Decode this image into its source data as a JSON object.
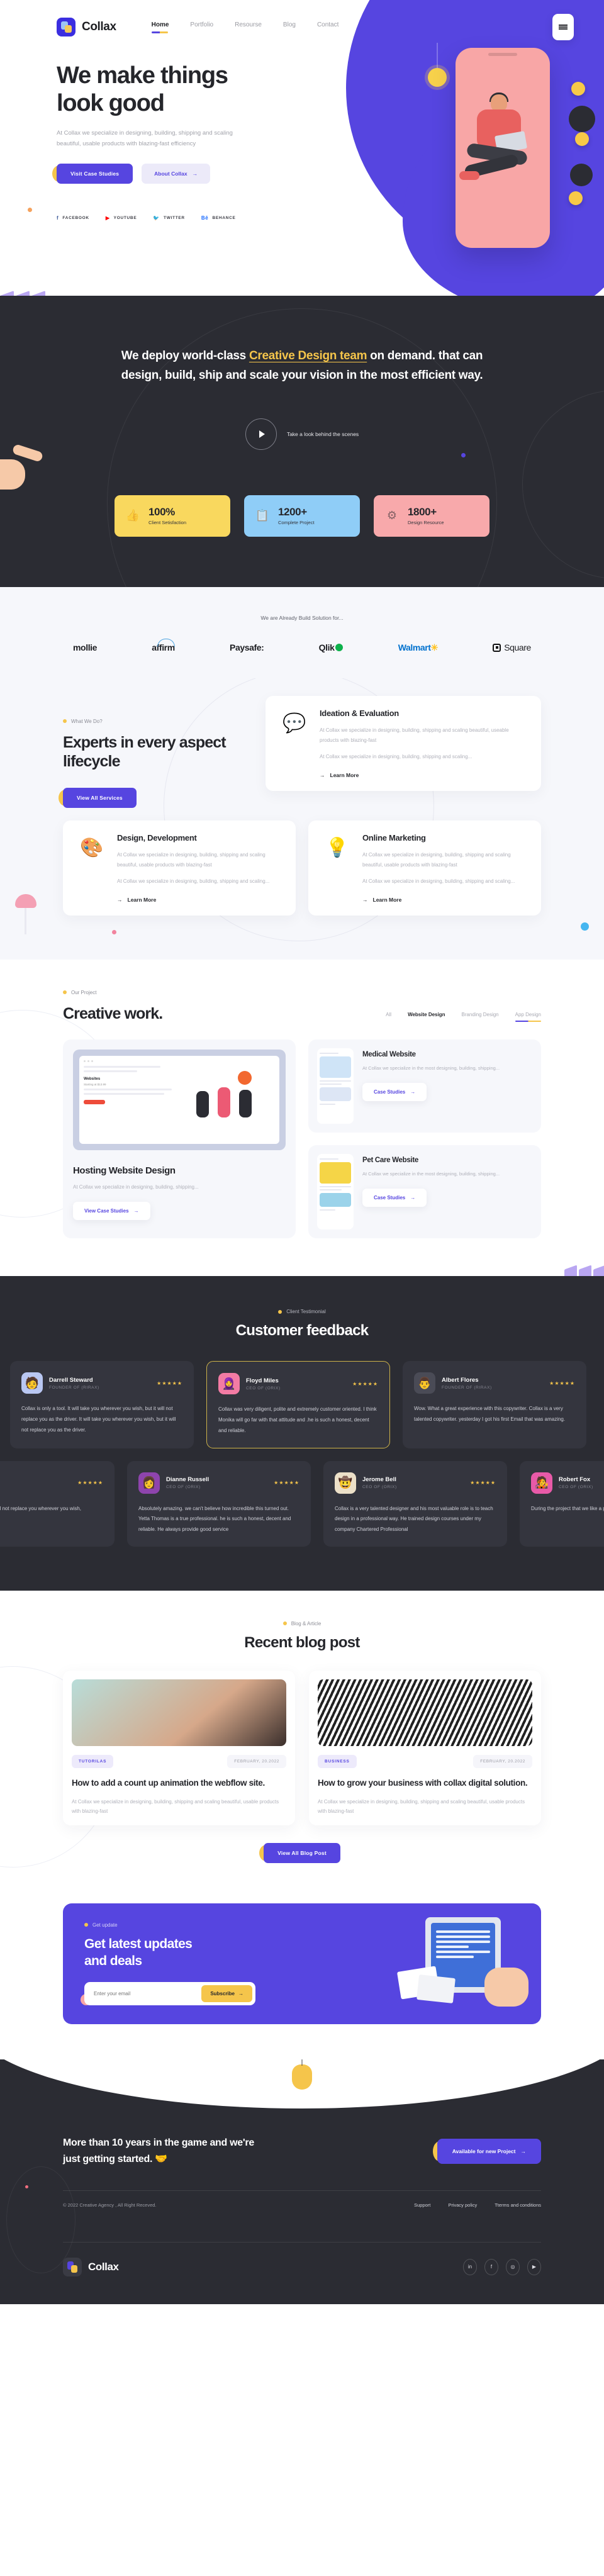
{
  "brand": {
    "name": "Collax"
  },
  "nav": {
    "items": [
      {
        "label": "Home",
        "active": true
      },
      {
        "label": "Portfolio",
        "active": false
      },
      {
        "label": "Resourse",
        "active": false
      },
      {
        "label": "Blog",
        "active": false
      },
      {
        "label": "Contact",
        "active": false
      }
    ],
    "menu_icon": "hamburger-icon"
  },
  "hero": {
    "title_line1": "We make things",
    "title_line2": "look good",
    "subtitle": "At Collax we specialize in designing, building, shipping and scaling beautiful, usable products with blazing-fast efficiency",
    "primary_cta": "Visit Case Studies",
    "secondary_cta": "About Collax",
    "secondary_arrow": "→",
    "socials": [
      {
        "label": "FACEBOOK",
        "icon": "facebook-icon",
        "glyph": "f"
      },
      {
        "label": "YOUTUBE",
        "icon": "youtube-icon",
        "glyph": "▶"
      },
      {
        "label": "TWITTER",
        "icon": "twitter-icon",
        "glyph": "🐦"
      },
      {
        "label": "BEHANCE",
        "icon": "behance-icon",
        "glyph": "Bē"
      }
    ]
  },
  "deploy": {
    "text_before": "We deploy world-class ",
    "highlight": "Creative Design team",
    "text_after": " on demand. that can design, build, ship and scale your vision in the most efficient way.",
    "play_label": "Take a look behind the scenes",
    "stats": [
      {
        "value": "100%",
        "label": "Client Setisfaction",
        "color": "#f9d85e",
        "icon": "thumbs-up-icon",
        "glyph": "👍"
      },
      {
        "value": "1200+",
        "label": "Complete Project",
        "color": "#8fcdf7",
        "icon": "clipboard-icon",
        "glyph": "📋"
      },
      {
        "value": "1800+",
        "label": "Design Resource",
        "color": "#f8a9ab",
        "icon": "gear-icon",
        "glyph": "⚙"
      }
    ]
  },
  "brands": {
    "title": "We are Already Build Solution for...",
    "items": [
      "mollie",
      "affirm",
      "Paysafe:",
      "Qlik",
      "Walmart",
      "Square"
    ]
  },
  "services": {
    "eyebrow": "What We Do?",
    "title": "Experts in every aspect lifecycle",
    "cta": "View All Services",
    "cards": [
      {
        "title": "Ideation & Evaluation",
        "icon": "chat-bubble-icon",
        "glyph": "💬",
        "p1": "At Collax we specialize in designing, building, shipping and scaling beautiful, useable products with blazing-fast",
        "p2": "At Collax we specialize in designing, building, shipping and scaling...",
        "link": "Learn More"
      },
      {
        "title": "Design, Development",
        "icon": "paint-bucket-icon",
        "glyph": "🎨",
        "p1": "At Collax we specialize in designing, building, shipping and scaling beautiful, usable products with blazing-fast",
        "p2": "At Collax we specialize in designing, building, shipping and scaling...",
        "link": "Learn More"
      },
      {
        "title": "Online Marketing",
        "icon": "lightbulb-icon",
        "glyph": "💡",
        "p1": "At Collax we specialize in designing, building, shipping and scaling beautiful, usable products with blazing-fast",
        "p2": "At Collax we specialize in designing, building, shipping and scaling...",
        "link": "Learn More"
      }
    ]
  },
  "portfolio": {
    "eyebrow": "Our Project",
    "title": "Creative work.",
    "tabs": [
      {
        "label": "All",
        "state": "normal"
      },
      {
        "label": "Website Design",
        "state": "bold"
      },
      {
        "label": "Branding Design",
        "state": "normal"
      },
      {
        "label": "App Design",
        "state": "underlined"
      }
    ],
    "featured": {
      "title": "Hosting Website Design",
      "desc": "At Collax we specialize in designing, building, shipping...",
      "cta": "View Case Studies",
      "cta_arrow": "→",
      "shot_heading": "Websites",
      "shot_sub": "Starting at $13.99"
    },
    "items": [
      {
        "title": "Medical Website",
        "desc": "At Collax we specialize in the most designing, building, shipping...",
        "cta": "Case Studies",
        "cta_arrow": "→"
      },
      {
        "title": "Pet Care Website",
        "desc": "At Collax we specialize in the most designing, building, shipping...",
        "cta": "Case Studies",
        "cta_arrow": "→"
      }
    ]
  },
  "testimonials": {
    "eyebrow": "Client Testimonial",
    "title": "Customer feedback",
    "row1": [
      {
        "name": "Darrell Steward",
        "role": "FOUNDER OF (RIRAX)",
        "stars": "★★★★★",
        "text": "Collax is only a tool. It will take you wherever you wish, but it will not replace you as the driver. It will take you wherever you wish, but it will not replace you as the driver.",
        "avatar_color": "#b9c7f2",
        "avatar_glyph": "🧑",
        "active": false
      },
      {
        "name": "Floyd Miles",
        "role": "CEO OF (ORIX)",
        "stars": "★★★★★",
        "text": "Collax was very diligent, polite and extremely customer oriented. I think Monika will go far with that attitude and  .he is such a honest, decent and reliable.",
        "avatar_color": "#f37ba4",
        "avatar_glyph": "🧕",
        "active": true
      },
      {
        "name": "Albert Flores",
        "role": "FOUNDER OF (RIRAX)",
        "stars": "★★★★★",
        "text": "Wow. What a great experience with this copywriter. Collax is a very talented copywriter. yesterday I got his first Email that was amazing.",
        "avatar_color": "#4a4b56",
        "avatar_glyph": "👨",
        "active": false
      }
    ],
    "row2": [
      {
        "name": "",
        "role": "",
        "stars": "★★★★★",
        "text": "...rever you wish, but it will not replace you wherever you wish,",
        "avatar_color": "#4a4b56",
        "avatar_glyph": "",
        "active": false
      },
      {
        "name": "Dianne Russell",
        "role": "CEO OF (ORIX)",
        "stars": "★★★★★",
        "text": "Absolutely amazing. we can't believe how incredible this turned out. Yetta Thomas is a true professional. he is such a honest, decent and reliable. He always provide good service",
        "avatar_color": "#8e44ad",
        "avatar_glyph": "👩",
        "active": false
      },
      {
        "name": "Jerome Bell",
        "role": "CEO OF (ORIX)",
        "stars": "★★★★★",
        "text": "Collax is a very talented designer and his most valuable role is to teach design in a professional way. He trained design courses under my company Chartered Professional",
        "avatar_color": "#ece0c8",
        "avatar_glyph": "🤠",
        "active": false
      },
      {
        "name": "Robert Fox",
        "role": "CEO OF (ORIX)",
        "stars": "★★★★★",
        "text": "During the project that we like a partner rather than to detail.",
        "avatar_color": "#e85aa8",
        "avatar_glyph": "🧑‍🎤",
        "active": false
      }
    ]
  },
  "blog": {
    "eyebrow": "Blog & Article",
    "title": "Recent blog post",
    "cta": "View All Blog Post",
    "posts": [
      {
        "tag": "TUTORILAS",
        "date": "FEBRUARY, 20.2022",
        "title": "How to add a count up animation the webflow site.",
        "excerpt": "At Collax we specialize in designing, building, shipping and scaling beautiful, usable products with blazing-fast"
      },
      {
        "tag": "BUSINESS",
        "date": "FEBRUARY, 20.2022",
        "title": "How to grow your business with collax digital solution.",
        "excerpt": "At Collax we specialize in designing, building, shipping and scaling beautiful, usable products with blazing-fast"
      }
    ]
  },
  "newsletter": {
    "eyebrow": "Get update",
    "title_line1": "Get latest updates",
    "title_line2": "and deals",
    "placeholder": "Enter your email",
    "button": "Subscribe",
    "button_arrow": "→"
  },
  "footer": {
    "headline_line1": "More than 10 years in the game and we're",
    "headline_line2": "just getting started.",
    "headline_emoji": "🤝",
    "cta": "Available for new Project",
    "cta_arrow": "→",
    "copyright": "© 2022 Creative  Agency , All Right Receved.",
    "links": [
      "Support",
      "Privacy policy",
      "Tterms and conditions"
    ],
    "brand": "Collax",
    "socials": [
      {
        "icon": "linkedin-icon",
        "glyph": "in"
      },
      {
        "icon": "facebook-icon",
        "glyph": "f"
      },
      {
        "icon": "instagram-icon",
        "glyph": "◎"
      },
      {
        "icon": "youtube-icon",
        "glyph": "▶"
      }
    ]
  },
  "colors": {
    "accent": "#5645e0",
    "yellow": "#f5c54b",
    "dark": "#2b2c33",
    "light": "#f6f7fb",
    "pink": "#f8a9ab",
    "blue": "#8fcdf7"
  }
}
